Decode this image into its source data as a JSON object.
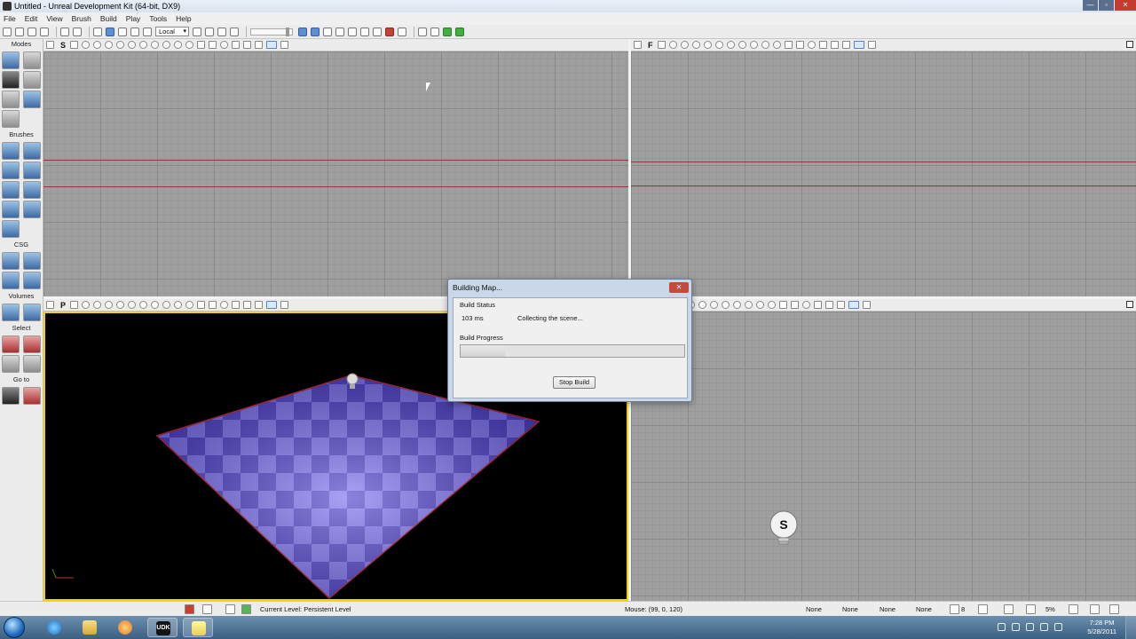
{
  "window": {
    "title": "Untitled - Unreal Development Kit (64-bit, DX9)",
    "min": "—",
    "max": "▫",
    "close": "✕"
  },
  "menu": [
    "File",
    "Edit",
    "View",
    "Brush",
    "Build",
    "Play",
    "Tools",
    "Help"
  ],
  "toolbar": {
    "coord_system": "Local"
  },
  "modes_panel": {
    "modes_label": "Modes",
    "brushes_label": "Brushes",
    "csg_label": "CSG",
    "volumes_label": "Volumes",
    "select_label": "Select",
    "goto_label": "Go to"
  },
  "viewports": {
    "top": {
      "type_letter": "S"
    },
    "front": {
      "type_letter": "F"
    },
    "perspective": {
      "type_letter": "P"
    },
    "side": {
      "type_letter": ""
    }
  },
  "dialog": {
    "title": "Building Map...",
    "build_status_label": "Build Status",
    "elapsed": "103 ms",
    "status_message": "Collecting the scene...",
    "build_progress_label": "Build Progress",
    "progress": 0.2,
    "stop_button": "Stop Build"
  },
  "statusbar": {
    "current_level": "Current Level:  Persistent Level",
    "mouse": "Mouse: (99, 0, 120)",
    "none_fields": [
      "None",
      "None",
      "None",
      "None"
    ],
    "grid_value": "8",
    "zoom_percent": "5%"
  },
  "taskbar": {
    "udk_label": "UDK",
    "clock_time": "7:28 PM",
    "clock_date": "5/28/2011"
  },
  "colors": {
    "selected_viewport_border": "#f6d300",
    "grid_bg": "#9f9f9f",
    "floor": "#5c4fd8"
  }
}
